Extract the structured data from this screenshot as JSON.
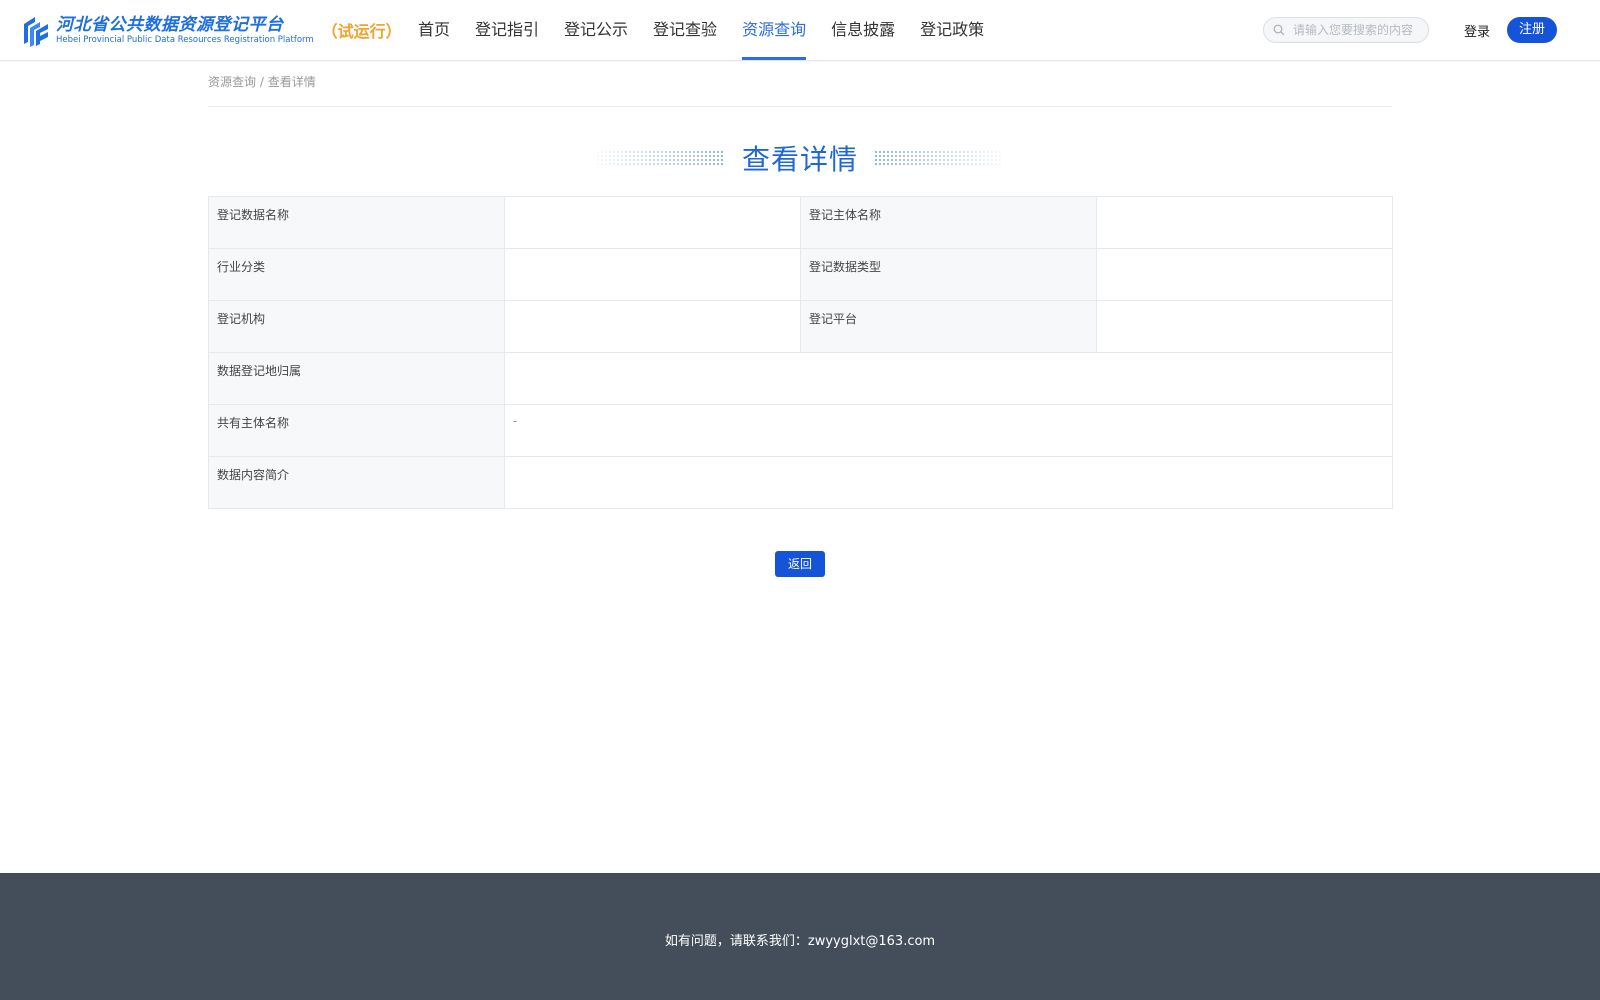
{
  "header": {
    "logo_cn": "河北省公共数据资源登记平台",
    "logo_en": "Hebei Provincial Public Data Resources Registration Platform",
    "trial": "（试运行）",
    "nav": [
      {
        "label": "首页",
        "active": false
      },
      {
        "label": "登记指引",
        "active": false
      },
      {
        "label": "登记公示",
        "active": false
      },
      {
        "label": "登记查验",
        "active": false
      },
      {
        "label": "资源查询",
        "active": true
      },
      {
        "label": "信息披露",
        "active": false
      },
      {
        "label": "登记政策",
        "active": false
      }
    ],
    "search_placeholder": "请输入您要搜索的内容",
    "login_label": "登录",
    "register_label": "注册"
  },
  "breadcrumb": {
    "parent": "资源查询",
    "separator": " / ",
    "current": "查看详情"
  },
  "page_title": "查看详情",
  "detail": {
    "data_name_label": "登记数据名称",
    "data_name_value": "",
    "subject_name_label": "登记主体名称",
    "subject_name_value": "",
    "industry_label": "行业分类",
    "industry_value": "",
    "data_type_label": "登记数据类型",
    "data_type_value": "",
    "agency_label": "登记机构",
    "agency_value": "",
    "platform_label": "登记平台",
    "platform_value": "",
    "region_label": "数据登记地归属",
    "region_value": "",
    "co_owner_label": "共有主体名称",
    "co_owner_value": "-",
    "summary_label": "数据内容简介",
    "summary_value": ""
  },
  "back_label": "返回",
  "footer": {
    "contact": "如有问题，请联系我们：zwyyglxt@163.com"
  },
  "colors": {
    "primary": "#1554d8",
    "nav_active": "#2e6be6",
    "title": "#1f66d6",
    "trial": "#f0a32e",
    "footer_bg": "#434e5a"
  }
}
